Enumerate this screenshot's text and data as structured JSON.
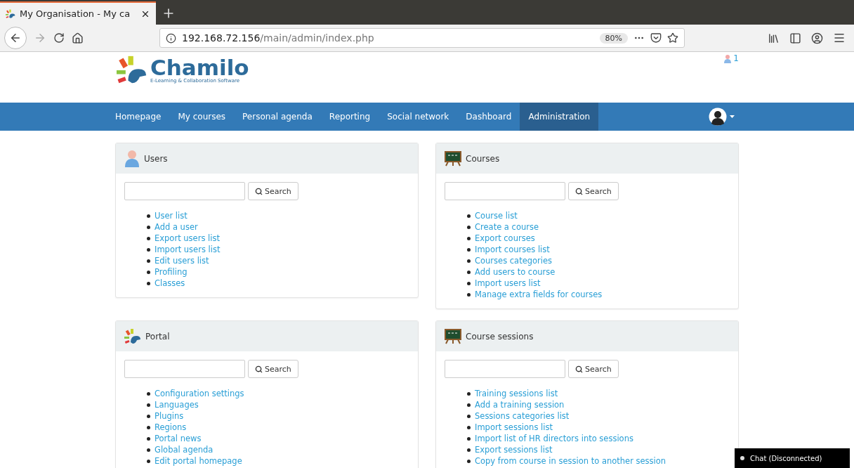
{
  "browser": {
    "tab_title": "My Organisation - My ca",
    "url_host": "192.168.72.156",
    "url_path": "/main/admin/index.php",
    "zoom": "80%"
  },
  "header": {
    "logo_name": "Chamilo",
    "logo_tagline": "E-Learning & Collaboration Software",
    "online_count": "1"
  },
  "nav": [
    {
      "label": "Homepage",
      "selected": false
    },
    {
      "label": "My courses",
      "selected": false
    },
    {
      "label": "Personal agenda",
      "selected": false
    },
    {
      "label": "Reporting",
      "selected": false
    },
    {
      "label": "Social network",
      "selected": false
    },
    {
      "label": "Dashboard",
      "selected": false
    },
    {
      "label": "Administration",
      "selected": true
    }
  ],
  "panels": [
    {
      "title": "Users",
      "kind": "user",
      "search_button": "Search",
      "items": [
        "User list",
        "Add a user",
        "Export users list",
        "Import users list",
        "Edit users list",
        "Profiling",
        "Classes"
      ]
    },
    {
      "title": "Courses",
      "kind": "board",
      "search_button": "Search",
      "items": [
        "Course list",
        "Create a course",
        "Export courses",
        "Import courses list",
        "Courses categories",
        "Add users to course",
        "Import users list",
        "Manage extra fields for courses"
      ]
    },
    {
      "title": "Portal",
      "kind": "logo",
      "search_button": "Search",
      "items": [
        "Configuration settings",
        "Languages",
        "Plugins",
        "Regions",
        "Portal news",
        "Global agenda",
        "Edit portal homepage"
      ]
    },
    {
      "title": "Course sessions",
      "kind": "board",
      "search_button": "Search",
      "items": [
        "Training sessions list",
        "Add a training session",
        "Sessions categories list",
        "Import sessions list",
        "Import list of HR directors into sessions",
        "Export sessions list",
        "Copy from course in session to another session"
      ]
    }
  ],
  "chat": {
    "label": "Chat (Disconnected)"
  }
}
